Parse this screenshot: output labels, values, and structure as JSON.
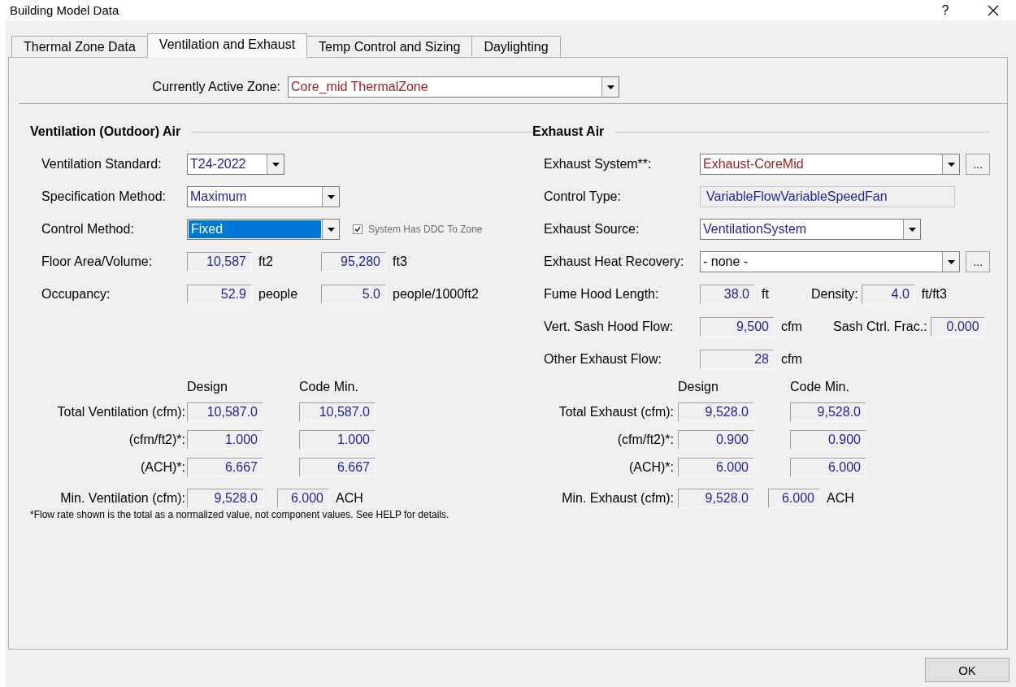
{
  "window": {
    "title": "Building Model Data",
    "help": "?"
  },
  "tabs": [
    {
      "label": "Thermal Zone Data",
      "selected": false
    },
    {
      "label": "Ventilation and Exhaust",
      "selected": true
    },
    {
      "label": "Temp Control and Sizing",
      "selected": false
    },
    {
      "label": "Daylighting",
      "selected": false
    }
  ],
  "active_zone": {
    "label": "Currently Active Zone:",
    "value": "Core_mid ThermalZone",
    "color": "#9b1c1c"
  },
  "ventilation": {
    "title": "Ventilation (Outdoor) Air",
    "fields": [
      {
        "kind": "dropdown",
        "label": "Ventilation Standard:",
        "value": "T24-2022",
        "color": "#1f1f9c",
        "selected": false
      },
      {
        "kind": "dropdown",
        "label": "Specification Method:",
        "value": "Maximum",
        "color": "#1f1f9c",
        "selected": false
      },
      {
        "kind": "dropdown",
        "label": "Control Method:",
        "value": "Fixed",
        "selected": true,
        "checkbox": {
          "label": "System Has DDC To Zone",
          "checked": true,
          "disabled": true
        }
      },
      {
        "kind": "readouts",
        "label": "Floor Area/Volume:",
        "readouts": [
          {
            "value": "10,587",
            "unit": "ft2"
          },
          {
            "value": "95,280",
            "unit": "ft3"
          }
        ]
      },
      {
        "kind": "readouts",
        "label": "Occupancy:",
        "readouts": [
          {
            "value": "52.9",
            "unit": "people"
          },
          {
            "value": "5.0",
            "unit": "people/1000ft2"
          }
        ]
      }
    ],
    "table": {
      "columns": [
        "Design",
        "Code Min."
      ],
      "rows": [
        {
          "label": "Total Ventilation (cfm):",
          "design": "10,587.0",
          "code_min": "10,587.0"
        },
        {
          "label": "(cfm/ft2)*:",
          "design": "1.000",
          "code_min": "1.000"
        },
        {
          "label": "(ACH)*:",
          "design": "6.667",
          "code_min": "6.667"
        }
      ]
    },
    "minimum": {
      "label": "Min. Ventilation (cfm):",
      "value": "9,528.0",
      "ach": "6.000",
      "unit": "ACH"
    },
    "footnote": "*Flow rate shown is the total as a normalized value, not component values. See HELP for details."
  },
  "exhaust": {
    "title": "Exhaust Air",
    "fields": [
      {
        "kind": "dropdown",
        "label": "Exhaust System**:",
        "value": "Exhaust-CoreMid",
        "color": "#9b1c1c",
        "selected": false,
        "browse": "..."
      },
      {
        "kind": "readonly",
        "label": "Control Type:",
        "value": "VariableFlowVariableSpeedFan",
        "color": "#1f1f9c"
      },
      {
        "kind": "dropdown",
        "label": "Exhaust Source:",
        "value": "VentilationSystem",
        "color": "#1f1f9c",
        "selected": false
      },
      {
        "kind": "dropdown",
        "label": "Exhaust Heat Recovery:",
        "value": "- none -",
        "color": "#000000",
        "selected": false,
        "browse": "..."
      },
      {
        "kind": "readouts",
        "label": "Fume Hood Length:",
        "readouts": [
          {
            "value": "38.0",
            "unit": "ft"
          },
          {
            "label": "Density:",
            "value": "4.0",
            "unit": "ft/ft3"
          }
        ]
      },
      {
        "kind": "readouts",
        "label": "Vert. Sash Hood Flow:",
        "readouts": [
          {
            "value": "9,500",
            "unit": "cfm"
          },
          {
            "label": "Sash Ctrl. Frac.:",
            "value": "0.000"
          }
        ]
      },
      {
        "kind": "readouts",
        "label": "Other Exhaust Flow:",
        "readouts": [
          {
            "value": "28",
            "unit": "cfm"
          }
        ]
      }
    ],
    "table": {
      "columns": [
        "Design",
        "Code Min."
      ],
      "rows": [
        {
          "label": "Total Exhaust (cfm):",
          "design": "9,528.0",
          "code_min": "9,528.0"
        },
        {
          "label": "(cfm/ft2)*:",
          "design": "0.900",
          "code_min": "0.900"
        },
        {
          "label": "(ACH)*:",
          "design": "6.000",
          "code_min": "6.000"
        }
      ]
    },
    "minimum": {
      "label": "Min. Exhaust (cfm):",
      "value": "9,528.0",
      "ach": "6.000",
      "unit": "ACH"
    }
  },
  "buttons": [
    "OK"
  ]
}
